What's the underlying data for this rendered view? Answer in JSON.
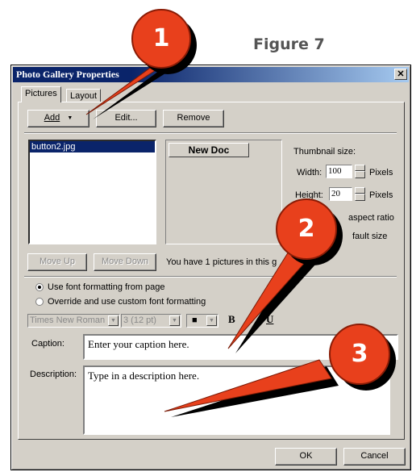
{
  "figure_label": "Figure 7",
  "dialog": {
    "title": "Photo Gallery Properties",
    "close_symbol": "✕"
  },
  "tabs": [
    "Pictures",
    "Layout"
  ],
  "toolbar": {
    "add_label": "Add",
    "add_arrow": "▼",
    "edit_label": "Edit...",
    "remove_label": "Remove"
  },
  "picture_list": {
    "items": [
      "button2.jpg"
    ],
    "selected_index": 0
  },
  "preview": {
    "button_label": "New Doc"
  },
  "thumbnail": {
    "title": "Thumbnail size:",
    "width_label": "Width:",
    "width_value": "100",
    "height_label": "Height:",
    "height_value": "20",
    "unit": "Pixels",
    "aspect_ratio_label": "aspect ratio",
    "default_size_label": "fault size"
  },
  "move": {
    "up_label": "Move Up",
    "down_label": "Move Down",
    "status_text": "You have 1 pictures in this g"
  },
  "font_options": {
    "use_page_label": "Use font formatting from page",
    "override_label": "Override and use custom font formatting",
    "selected": "use_page",
    "font_name": "Times New Roman",
    "font_size": "3  (12 pt)",
    "color_swatch": "■",
    "bold": "B",
    "italic": "I",
    "underline": "U"
  },
  "caption": {
    "label": "Caption:",
    "value": "Enter your caption here."
  },
  "description": {
    "label": "Description:",
    "value": "Type in a description here."
  },
  "footer": {
    "ok_label": "OK",
    "cancel_label": "Cancel"
  },
  "callouts": [
    "1",
    "2",
    "3"
  ],
  "colors": {
    "callout_fill": "#e8401c",
    "callout_shadow": "#000000",
    "titlebar": "#0a246a",
    "dialog_face": "#d4d0c8"
  }
}
